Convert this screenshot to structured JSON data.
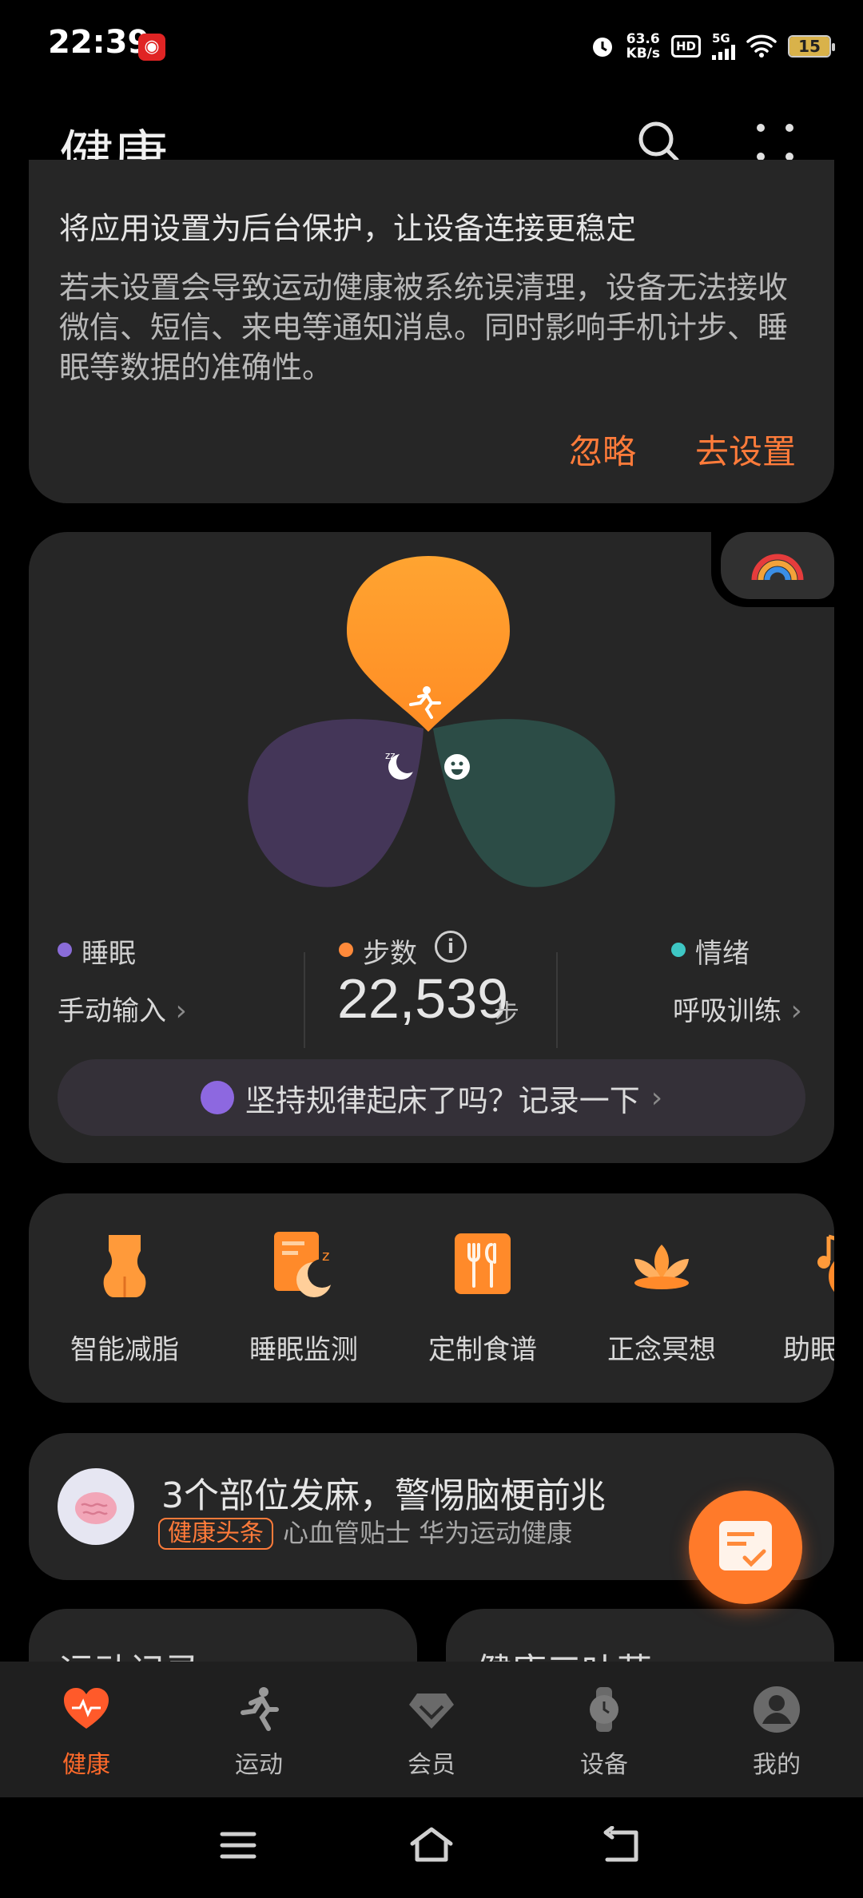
{
  "status_bar": {
    "time": "22:39",
    "app_badge": "◉",
    "net_speed_top": "63.6",
    "net_speed_bottom": "KB/s",
    "hd": "HD",
    "network": "5G",
    "battery": "15"
  },
  "header": {
    "title": "健康"
  },
  "notice": {
    "title": "将应用设置为后台保护，让设备连接更稳定",
    "body": "若未设置会导致运动健康被系统误清理，设备无法接收微信、短信、来电等通知消息。同时影响手机计步、睡眠等数据的准确性。",
    "ignore_label": "忽略",
    "set_label": "去设置"
  },
  "summary": {
    "sleep_label": "睡眠",
    "sleep_action": "手动输入",
    "steps_label": "步数",
    "steps_value": "22,539",
    "steps_unit": "步",
    "mood_label": "情绪",
    "mood_action": "呼吸训练",
    "prompt": "坚持规律起床了吗？记录一下",
    "colors": {
      "sleep": "#8a6cd8",
      "steps": "#ff8a3a",
      "mood": "#3ec7c4"
    }
  },
  "services": [
    {
      "label": "智能减脂",
      "icon": "waist-icon"
    },
    {
      "label": "睡眠监测",
      "icon": "sleep-monitor-icon"
    },
    {
      "label": "定制食谱",
      "icon": "recipe-icon"
    },
    {
      "label": "正念冥想",
      "icon": "lotus-icon"
    },
    {
      "label": "助眠",
      "icon": "music-note-icon"
    }
  ],
  "news": {
    "title": "3个部位发麻，警惕脑梗前兆",
    "tag": "健康头条",
    "source": "心血管贴士 华为运动健康"
  },
  "partial_cards": {
    "left_title": "运动记录",
    "right_title": "健康三叶草"
  },
  "tabs": [
    {
      "label": "健康",
      "icon": "heart-icon",
      "active": true
    },
    {
      "label": "运动",
      "icon": "runner-icon",
      "active": false
    },
    {
      "label": "会员",
      "icon": "diamond-icon",
      "active": false
    },
    {
      "label": "设备",
      "icon": "watch-icon",
      "active": false
    },
    {
      "label": "我的",
      "icon": "profile-icon",
      "active": false
    }
  ],
  "accent_color": "#ff7b3a"
}
